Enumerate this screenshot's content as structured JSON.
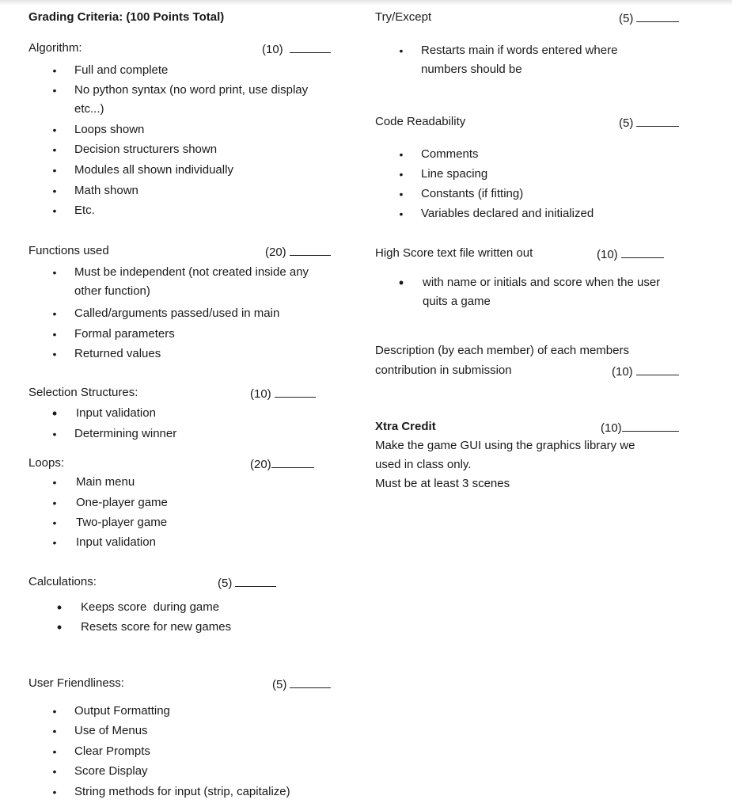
{
  "title": "Grading Criteria: (100 Points Total)",
  "left_sections": [
    {
      "heading": "Algorithm:",
      "points": "(10)",
      "bullets": [
        "Full and complete",
        "No python syntax (no word print, use display etc...)",
        "Loops shown",
        "Decision structurers shown",
        "Modules all shown individually",
        "Math shown",
        "Etc."
      ]
    },
    {
      "heading": "Functions used",
      "points": "(20)",
      "bullets": [
        "Must be independent (not created inside any other function)",
        "Called/arguments passed/used in main",
        "Formal parameters",
        "Returned values"
      ]
    },
    {
      "heading": "Selection Structures:",
      "points": "(10)",
      "bullets": [
        "Input validation",
        "Determining winner"
      ]
    },
    {
      "heading": "Loops:",
      "points": "(20)",
      "bullets": [
        "Main menu",
        "One-player game",
        "Two-player game",
        "Input validation"
      ]
    },
    {
      "heading": "Calculations:",
      "points": "(5)",
      "bullets": [
        "Keeps score  during game",
        "Resets score for new games"
      ]
    },
    {
      "heading": "User Friendliness:",
      "points": "(5)",
      "bullets": [
        "Output Formatting",
        "Use of Menus",
        "Clear Prompts",
        "Score Display",
        "String methods for input (strip, capitalize)"
      ]
    }
  ],
  "right_sections": [
    {
      "heading": "Try/Except",
      "points": "(5)",
      "bullets": [
        "Restarts main if words entered where numbers should be"
      ]
    },
    {
      "heading": "Code Readability",
      "points": "(5)",
      "bullets": [
        "Comments",
        "Line spacing",
        "Constants (if fitting)",
        "Variables declared and initialized"
      ]
    },
    {
      "heading": "High Score text file written out",
      "points": "(10)",
      "bullets": [
        "with name or initials and score when the user quits a game"
      ]
    },
    {
      "heading_line1": "Description (by each member) of each members",
      "heading_line2": "contribution in submission",
      "points": "(10)"
    },
    {
      "heading": "Xtra Credit",
      "points": "(10)",
      "lines": [
        "Make the game GUI using the graphics library we",
        "used in class only.",
        "Must be at least 3 scenes"
      ]
    }
  ],
  "bullet_glyph": "•"
}
